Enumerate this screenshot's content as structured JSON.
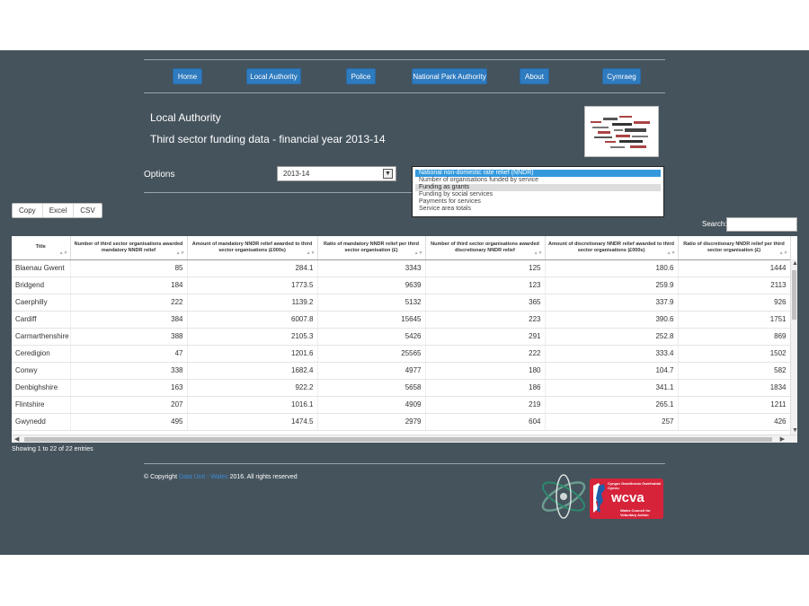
{
  "nav": {
    "items": [
      {
        "label": "Home"
      },
      {
        "label": "Local Authority"
      },
      {
        "label": "Police"
      },
      {
        "label": "National Park Authority"
      },
      {
        "label": "About"
      },
      {
        "label": "Cymraeg"
      }
    ]
  },
  "header": {
    "title": "Local Authority",
    "subtitle": "Third sector funding data - financial year 2013-14"
  },
  "options": {
    "label": "Options",
    "year_selected": "2013-14",
    "list": [
      "National non-domestic rate relief (NNDR)",
      "Number of organisations funded by service",
      "Funding as grants",
      "Funding by social services",
      "Payments for services",
      "Service area totals"
    ]
  },
  "toolbar": {
    "copy": "Copy",
    "excel": "Excel",
    "csv": "CSV"
  },
  "search": {
    "label": "Search:",
    "value": ""
  },
  "table": {
    "headers": [
      "Title",
      "Number of third sector organisations awarded mandatory NNDR relief",
      "Amount of mandatory NNDR relief awarded to third sector organisations (£000s)",
      "Ratio of mandatory NNDR relief per third sector organisation (£)",
      "Number of third sector organisations awarded discretionary NNDR relief",
      "Amount of discretionary NNDR relief awarded to third sector organisations (£000s)",
      "Ratio of discretionary NNDR relief per third sector organisation (£)"
    ],
    "rows": [
      [
        "Blaenau Gwent",
        "85",
        "284.1",
        "3343",
        "125",
        "180.6",
        "1444"
      ],
      [
        "Bridgend",
        "184",
        "1773.5",
        "9639",
        "123",
        "259.9",
        "2113"
      ],
      [
        "Caerphilly",
        "222",
        "1139.2",
        "5132",
        "365",
        "337.9",
        "926"
      ],
      [
        "Cardiff",
        "384",
        "6007.8",
        "15645",
        "223",
        "390.6",
        "1751"
      ],
      [
        "Carmarthenshire",
        "388",
        "2105.3",
        "5426",
        "291",
        "252.8",
        "869"
      ],
      [
        "Ceredigion",
        "47",
        "1201.6",
        "25565",
        "222",
        "333.4",
        "1502"
      ],
      [
        "Conwy",
        "338",
        "1682.4",
        "4977",
        "180",
        "104.7",
        "582"
      ],
      [
        "Denbighshire",
        "163",
        "922.2",
        "5658",
        "186",
        "341.1",
        "1834"
      ],
      [
        "Flintshire",
        "207",
        "1016.1",
        "4909",
        "219",
        "265.1",
        "1211"
      ],
      [
        "Gwynedd",
        "495",
        "1474.5",
        "2979",
        "604",
        "257",
        "426"
      ]
    ]
  },
  "info": "Showing 1 to 22 of 22 entries",
  "footer": {
    "copyright_prefix": "© Copyright",
    "link": "Data Unit - Wales",
    "copyright_suffix": "2016. All rights reserved",
    "logo_text_1": "Cyngor Gweithredu Gwirfoddol Cymru",
    "logo_text_2": "wcva",
    "logo_text_3": "Wales Council for Voluntary Action"
  },
  "colors": {
    "background": "#45535c",
    "nav_button": "#2f7bbf",
    "wcva_red": "#d6233a"
  }
}
